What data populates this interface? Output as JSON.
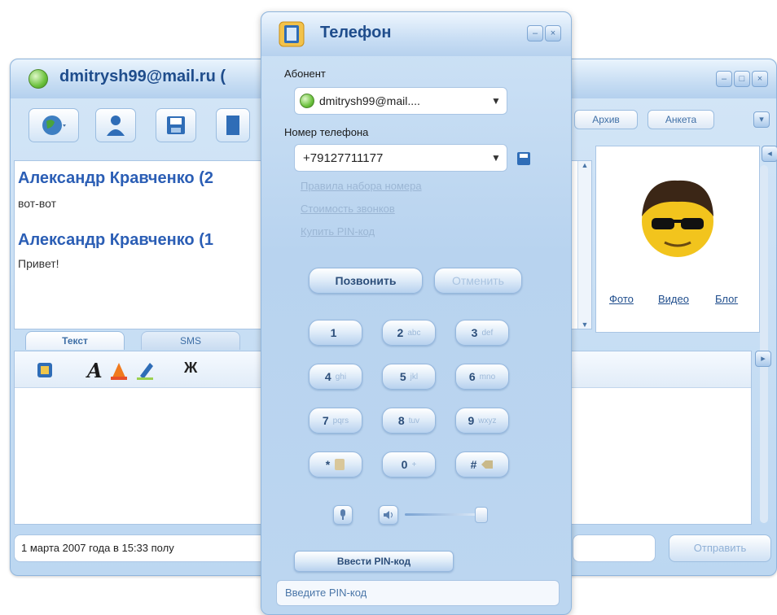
{
  "chat_window": {
    "title": "dmitrysh99@mail.ru (",
    "toolbar": {
      "archive_label": "Архив",
      "profile_label": "Анкета"
    },
    "history": [
      {
        "sender": "Александр Кравченко (2",
        "text": "вот-вот"
      },
      {
        "sender": "Александр Кравченко (1",
        "text": "Привет!"
      }
    ],
    "avatar_links": {
      "photo": "Фото",
      "video": "Видео",
      "blog": "Блог"
    },
    "tabs": {
      "text": "Текст",
      "sms": "SMS"
    },
    "bold_label": "Ж",
    "status_text": "1 марта 2007 года в 15:33 полу",
    "send_label": "Отправить"
  },
  "phone_dialog": {
    "title": "Телефон",
    "subscriber_label": "Абонент",
    "subscriber_value": "dmitrysh99@mail....",
    "phone_label": "Номер телефона",
    "phone_value": "+79127711177",
    "links": [
      "Правила набора номера",
      "Стоимость звонков",
      "Купить PIN-код"
    ],
    "call_label": "Позвонить",
    "hangup_label": "Отменить",
    "keypad": [
      {
        "digit": "1",
        "sub": ""
      },
      {
        "digit": "2",
        "sub": "abc"
      },
      {
        "digit": "3",
        "sub": "def"
      },
      {
        "digit": "4",
        "sub": "ghi"
      },
      {
        "digit": "5",
        "sub": "jkl"
      },
      {
        "digit": "6",
        "sub": "mno"
      },
      {
        "digit": "7",
        "sub": "pqrs"
      },
      {
        "digit": "8",
        "sub": "tuv"
      },
      {
        "digit": "9",
        "sub": "wxyz"
      },
      {
        "digit": "*",
        "sub": ""
      },
      {
        "digit": "0",
        "sub": "+"
      },
      {
        "digit": "#",
        "sub": ""
      }
    ],
    "enter_pin_button": "Ввести PIN-код",
    "pin_status": "Введите PIN-код"
  },
  "colors": {
    "accent": "#2b5eb5",
    "window_bg": "#c4dbf2",
    "title_text": "#1f4d8c"
  }
}
